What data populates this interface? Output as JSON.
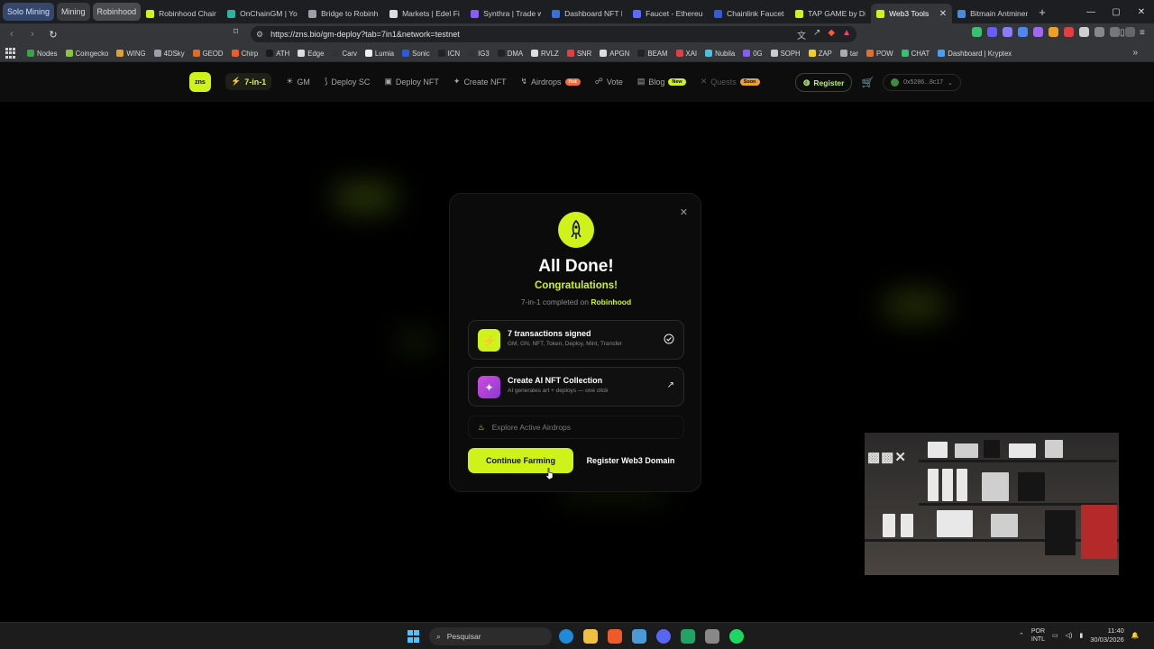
{
  "browser": {
    "tab_groups": [
      "Solo Mining",
      "Mining",
      "Robinhood"
    ],
    "tabs": [
      {
        "title": "Robinhood Chain",
        "color": "#cff21a"
      },
      {
        "title": "OnChainGM | You",
        "color": "#2fb3a1"
      },
      {
        "title": "Bridge to Robinh",
        "color": "#9aa0a6"
      },
      {
        "title": "Markets | Edel Fin",
        "color": "#dddddd"
      },
      {
        "title": "Synthra | Trade w",
        "color": "#8a5cf6"
      },
      {
        "title": "Dashboard NFT L",
        "color": "#3b6fd8"
      },
      {
        "title": "Faucet - Ethereum",
        "color": "#5b6bff"
      },
      {
        "title": "Chainlink Faucets",
        "color": "#375bd2"
      },
      {
        "title": "TAP GAME by Dis",
        "color": "#cff21a"
      },
      {
        "title": "Web3 Tools",
        "color": "#cff21a"
      },
      {
        "title": "Bitmain Antminer",
        "color": "#4a8ad8"
      }
    ],
    "active_tab_index": 9,
    "url": "https://zns.bio/gm-deploy?tab=7in1&network=testnet",
    "bookmarks": [
      {
        "label": "Nodes",
        "color": "#3aa34a"
      },
      {
        "label": "Coingecko",
        "color": "#8bc53f"
      },
      {
        "label": "WING",
        "color": "#e0a030"
      },
      {
        "label": "4DSky",
        "color": "#9aa0a6"
      },
      {
        "label": "GEOD",
        "color": "#e06a2a"
      },
      {
        "label": "Chirp",
        "color": "#f05a28"
      },
      {
        "label": "ATH",
        "color": "#1a1a1a"
      },
      {
        "label": "Edge",
        "color": "#dddddd"
      },
      {
        "label": "Carv",
        "color": "#333333"
      },
      {
        "label": "Lumia",
        "color": "#eeeeee"
      },
      {
        "label": "Sonic",
        "color": "#2a5bd8"
      },
      {
        "label": "ICN",
        "color": "#222222"
      },
      {
        "label": "IG3",
        "color": "#333333"
      },
      {
        "label": "DMA",
        "color": "#222222"
      },
      {
        "label": "RVLZ",
        "color": "#dddddd"
      },
      {
        "label": "SNR",
        "color": "#e04040"
      },
      {
        "label": "APGN",
        "color": "#dddddd"
      },
      {
        "label": "BEAM",
        "color": "#222222"
      },
      {
        "label": "XAI",
        "color": "#e04040"
      },
      {
        "label": "Nubila",
        "color": "#4ac0e0"
      },
      {
        "label": "0G",
        "color": "#8a5cf6"
      },
      {
        "label": "SOPH",
        "color": "#cccccc"
      },
      {
        "label": "ZAP",
        "color": "#f0d020"
      },
      {
        "label": "tar",
        "color": "#aaaaaa"
      },
      {
        "label": "POW",
        "color": "#e07030"
      },
      {
        "label": "CHAT",
        "color": "#3ac070"
      },
      {
        "label": "Dashboard | Kryptex",
        "color": "#4aa0f0"
      }
    ]
  },
  "site": {
    "logo": "zns",
    "nav": [
      {
        "label": "7-in-1",
        "icon": "⚡"
      },
      {
        "label": "GM",
        "icon": "☀"
      },
      {
        "label": "Deploy SC",
        "icon": "⟆"
      },
      {
        "label": "Deploy NFT",
        "icon": "▣"
      },
      {
        "label": "Create NFT",
        "icon": "✦"
      },
      {
        "label": "Airdrops",
        "icon": "↯",
        "badge": "Hot"
      },
      {
        "label": "Vote",
        "icon": "☍"
      },
      {
        "label": "Blog",
        "icon": "▤",
        "badge": "New"
      },
      {
        "label": "Quests",
        "icon": "✕",
        "badge": "Soon"
      }
    ],
    "register_label": "Register",
    "wallet": "0x5286...8c17"
  },
  "modal": {
    "title": "All Done!",
    "subtitle": "Congratulations!",
    "completed_prefix": "7-in-1 completed on",
    "network": "Robinhood",
    "card1": {
      "title": "7 transactions signed",
      "sub": "GM, GN, NFT, Token, Deploy, Mint, Transfer"
    },
    "card2": {
      "title": "Create AI NFT Collection",
      "sub": "AI generates art + deploys — one click"
    },
    "explore": "Explore Active Airdrops",
    "continue_label": "Continue Farming",
    "register_domain_label": "Register Web3 Domain"
  },
  "taskbar": {
    "search_placeholder": "Pesquisar",
    "lang_top": "POR",
    "lang_bottom": "INTL",
    "time": "11:40",
    "date": "30/03/2026"
  },
  "colors": {
    "accent": "#cff21a",
    "purple": "#b14be0"
  }
}
